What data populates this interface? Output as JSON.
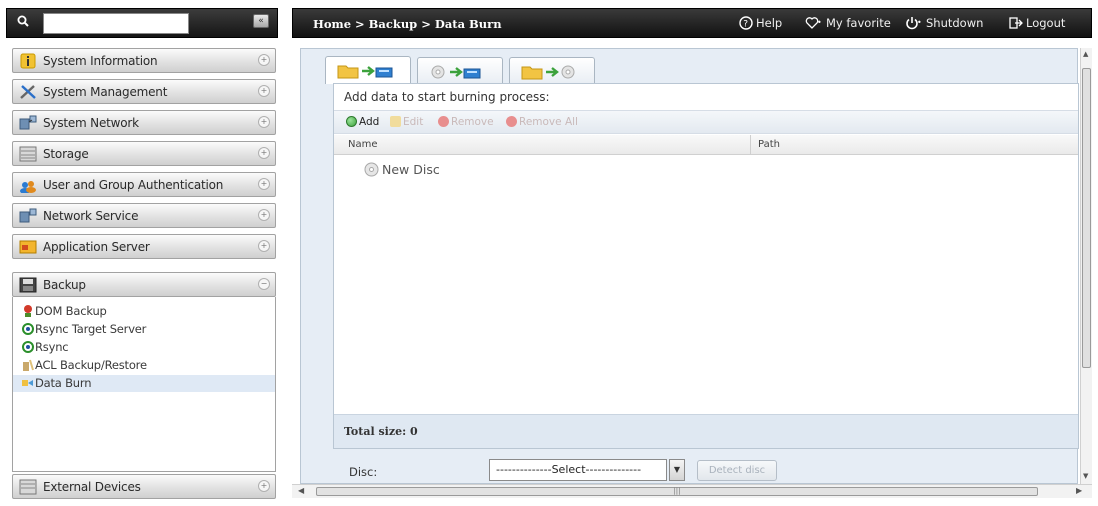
{
  "sidebar": {
    "search_placeholder": "",
    "items": [
      {
        "label": "System Information",
        "toggle": "+"
      },
      {
        "label": "System Management",
        "toggle": "+"
      },
      {
        "label": "System Network",
        "toggle": "+"
      },
      {
        "label": "Storage",
        "toggle": "+"
      },
      {
        "label": "User and Group Authentication",
        "toggle": "+"
      },
      {
        "label": "Network Service",
        "toggle": "+"
      },
      {
        "label": "Application Server",
        "toggle": "+"
      },
      {
        "label": "Backup",
        "toggle": "−"
      }
    ],
    "backup_subitems": [
      {
        "label": "DOM Backup"
      },
      {
        "label": "Rsync Target Server"
      },
      {
        "label": "Rsync"
      },
      {
        "label": "ACL Backup/Restore"
      },
      {
        "label": "Data Burn"
      }
    ],
    "bottom_item": {
      "label": "External Devices",
      "toggle": "+"
    }
  },
  "header": {
    "breadcrumb": [
      "Home",
      "Backup",
      "Data Burn"
    ],
    "breadcrumb_sep": ">",
    "help": "Help",
    "favorite": "My favorite",
    "shutdown": "Shutdown",
    "logout": "Logout"
  },
  "panel": {
    "title": "Add data to start burning process:",
    "toolbar": {
      "add": "Add",
      "edit": "Edit",
      "remove": "Remove",
      "remove_all": "Remove All"
    },
    "columns": {
      "name": "Name",
      "path": "Path"
    },
    "tree_root": "New Disc",
    "total_size_label": "Total size:",
    "total_size_value": "0"
  },
  "disc": {
    "label": "Disc:",
    "selected": "--------------Select--------------",
    "detect_button": "Detect disc"
  },
  "colors": {
    "accent_green": "#3ca23c",
    "remove_red": "#e06060",
    "header_dark": "#111111"
  }
}
